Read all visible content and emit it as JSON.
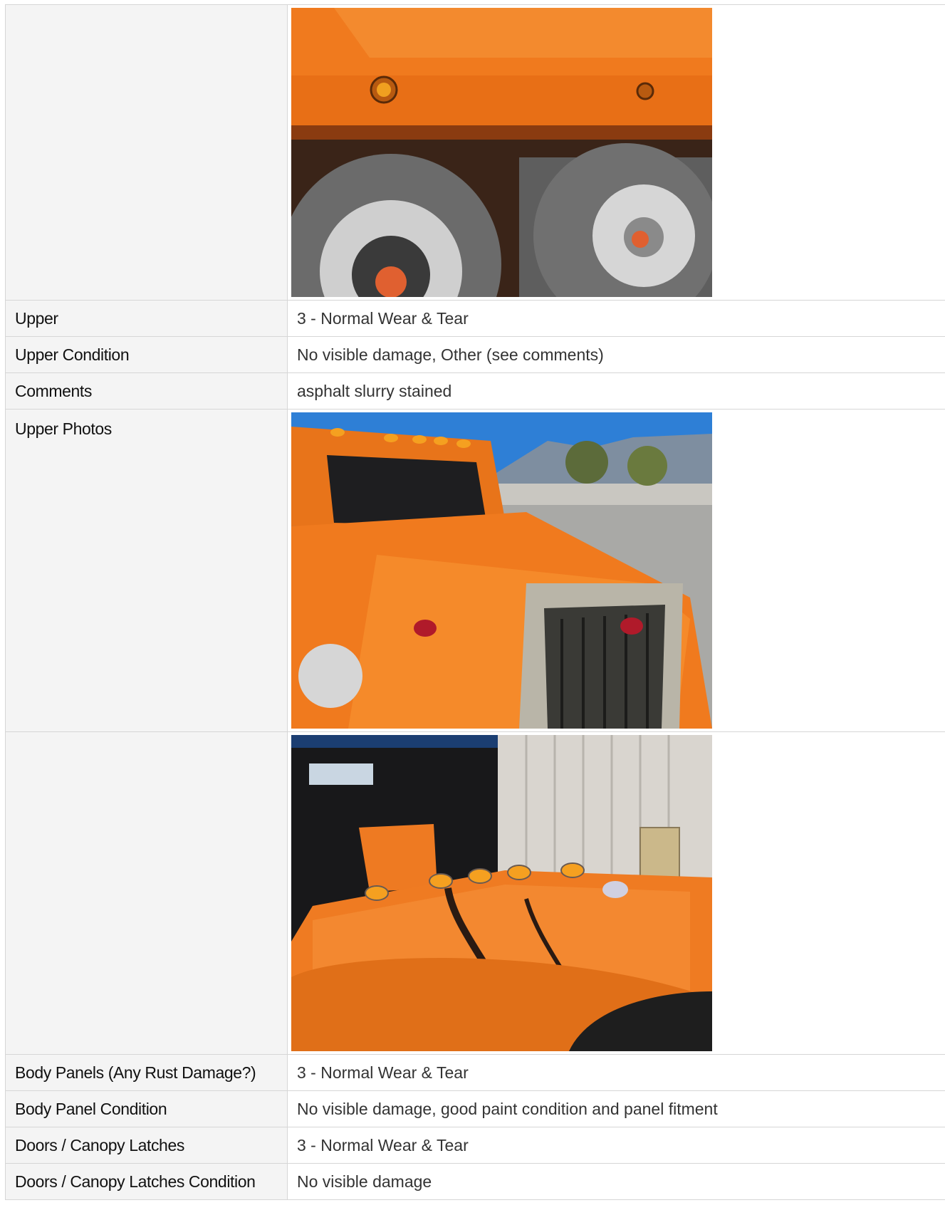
{
  "rows": [
    {
      "label": "",
      "photo": "rear-tires-photo"
    },
    {
      "label": "Upper",
      "value": "3 - Normal Wear & Tear"
    },
    {
      "label": "Upper Condition",
      "value": "No visible damage, Other (see comments)"
    },
    {
      "label": "Comments",
      "value": "asphalt slurry stained"
    },
    {
      "label": "Upper Photos",
      "photo": "truck-cab-front-photo"
    },
    {
      "label": "",
      "photo": "cab-roof-photo"
    },
    {
      "label": "Body Panels (Any Rust Damage?)",
      "value": "3 - Normal Wear & Tear"
    },
    {
      "label": "Body Panel Condition",
      "value": "No visible damage, good paint condition and panel fitment"
    },
    {
      "label": "Doors / Canopy Latches",
      "value": "3 - Normal Wear & Tear"
    },
    {
      "label": "Doors / Canopy Latches Condition",
      "value": "No visible damage"
    }
  ],
  "colors": {
    "label_bg": "#f4f4f4",
    "border": "#d6d6d6",
    "truck_orange": "#f07a1e"
  }
}
